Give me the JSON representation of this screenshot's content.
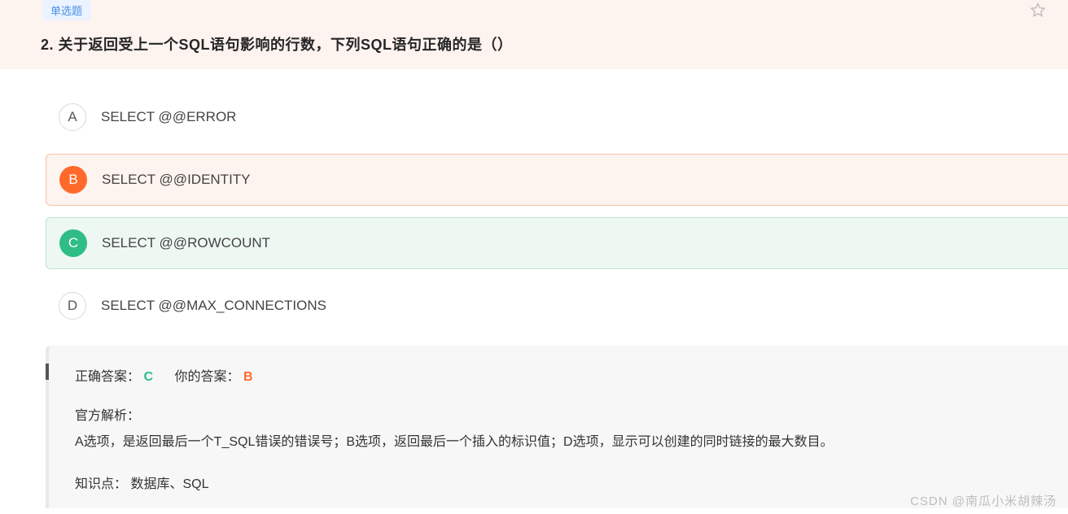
{
  "header": {
    "tag": "单选题",
    "question_number": "2.",
    "question_text": "关于返回受上一个SQL语句影响的行数，下列SQL语句正确的是（）"
  },
  "options": {
    "A": {
      "letter": "A",
      "text": "SELECT @@ERROR",
      "state": "plain"
    },
    "B": {
      "letter": "B",
      "text": "SELECT @@IDENTITY",
      "state": "wrong"
    },
    "C": {
      "letter": "C",
      "text": "SELECT @@ROWCOUNT",
      "state": "correct"
    },
    "D": {
      "letter": "D",
      "text": "SELECT @@MAX_CONNECTIONS",
      "state": "plain"
    }
  },
  "explanation": {
    "correct_label": "正确答案：",
    "correct_value": "C",
    "user_label": "你的答案：",
    "user_value": "B",
    "explain_title": "官方解析：",
    "explain_text": "A选项，是返回最后一个T_SQL错误的错误号；B选项，返回最后一个插入的标识值；D选项，显示可以创建的同时链接的最大数目。",
    "knowledge_label": "知识点：",
    "knowledge_value": "数据库、SQL"
  },
  "watermark": "CSDN @南瓜小米胡辣汤"
}
